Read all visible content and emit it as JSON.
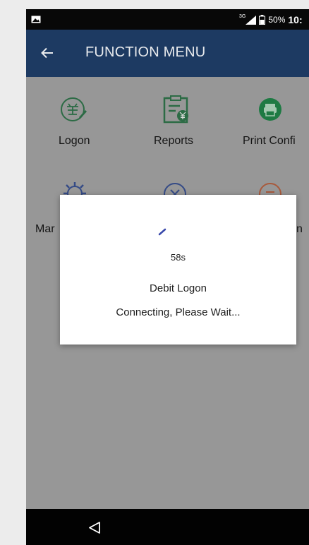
{
  "status_bar": {
    "network_label": "3G",
    "battery": "50%",
    "time": "10:"
  },
  "app_bar": {
    "title": "FUNCTION MENU",
    "back_icon": "arrow-left-icon"
  },
  "menu": {
    "items": [
      {
        "label": "Logon",
        "icon": "sign-stamp-icon"
      },
      {
        "label": "Reports",
        "icon": "receipt-yen-icon"
      },
      {
        "label": "Print Confi",
        "icon": "printer-icon"
      },
      {
        "label": "Mar",
        "icon": "gear-icon"
      },
      {
        "label": "",
        "icon": "cancel-circle-icon"
      },
      {
        "label": "n",
        "icon": "refresh-list-icon"
      }
    ]
  },
  "dialog": {
    "countdown": "58s",
    "line1": "Debit Logon",
    "line2": "Connecting, Please Wait..."
  },
  "nav_bar": {
    "back_icon": "nav-back-triangle-icon"
  },
  "colors": {
    "app_bar": "#1d3a62",
    "status_bar": "#080808",
    "overlay_bg": "#979797",
    "icon_green": "#1e7a43",
    "icon_green_outline": "#2c6b45",
    "icon_orange": "#a85a3c",
    "icon_blue": "#354b86",
    "spinner": "#3949ab"
  }
}
